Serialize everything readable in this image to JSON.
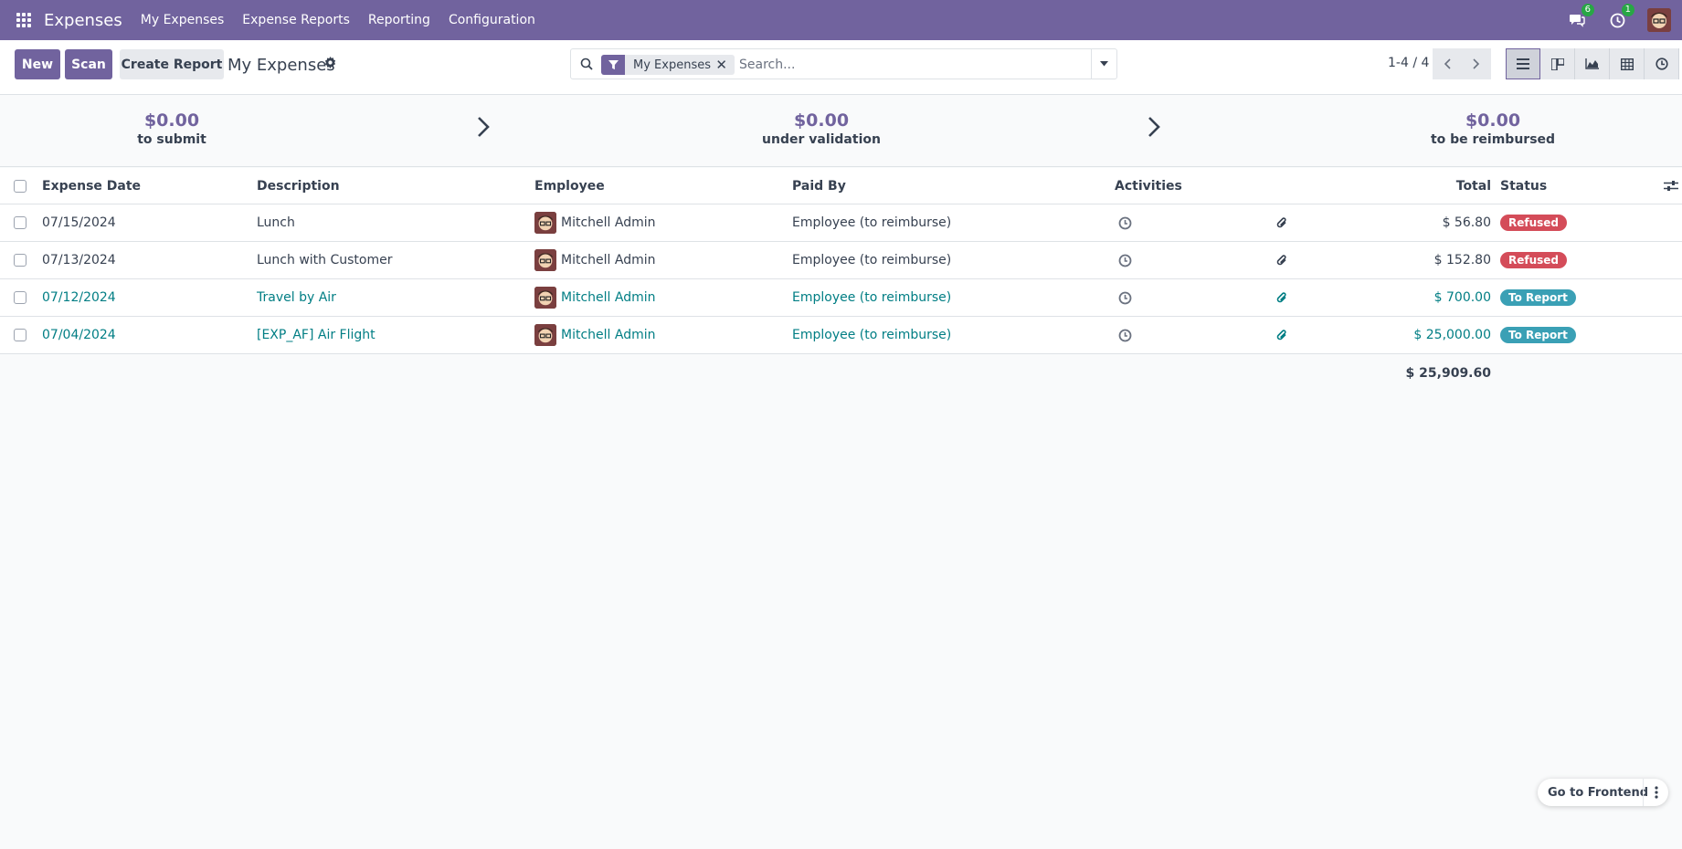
{
  "navbar": {
    "app_name": "Expenses",
    "menu": [
      "My Expenses",
      "Expense Reports",
      "Reporting",
      "Configuration"
    ],
    "messages_count": "6",
    "activities_count": "1",
    "color": "#71639e"
  },
  "control": {
    "new_label": "New",
    "scan_label": "Scan",
    "create_report_label": "Create Report",
    "title": "My Expenses",
    "search": {
      "facet": "My Expenses",
      "placeholder": "Search..."
    },
    "pager": "1-4 / 4"
  },
  "dashboard": [
    {
      "amount": "$0.00",
      "label": "to submit"
    },
    {
      "amount": "$0.00",
      "label": "under validation"
    },
    {
      "amount": "$0.00",
      "label": "to be reimbursed"
    }
  ],
  "table": {
    "columns": {
      "date": "Expense Date",
      "description": "Description",
      "employee": "Employee",
      "paid_by": "Paid By",
      "activities": "Activities",
      "total": "Total",
      "status": "Status"
    },
    "rows": [
      {
        "date": "07/15/2024",
        "description": "Lunch",
        "employee": "Mitchell Admin",
        "paid_by": "Employee (to reimburse)",
        "total": "$ 56.80",
        "status": "Refused",
        "link": false
      },
      {
        "date": "07/13/2024",
        "description": "Lunch with Customer",
        "employee": "Mitchell Admin",
        "paid_by": "Employee (to reimburse)",
        "total": "$ 152.80",
        "status": "Refused",
        "link": false
      },
      {
        "date": "07/12/2024",
        "description": "Travel by Air",
        "employee": "Mitchell Admin",
        "paid_by": "Employee (to reimburse)",
        "total": "$ 700.00",
        "status": "To Report",
        "link": true
      },
      {
        "date": "07/04/2024",
        "description": "[EXP_AF] Air Flight",
        "employee": "Mitchell Admin",
        "paid_by": "Employee (to reimburse)",
        "total": "$ 25,000.00",
        "status": "To Report",
        "link": true
      }
    ],
    "grand_total": "$ 25,909.60"
  },
  "frontend_button": "Go to Frontend",
  "status_colors": {
    "Refused": "#d44c59",
    "To Report": "#3aa0b5"
  }
}
